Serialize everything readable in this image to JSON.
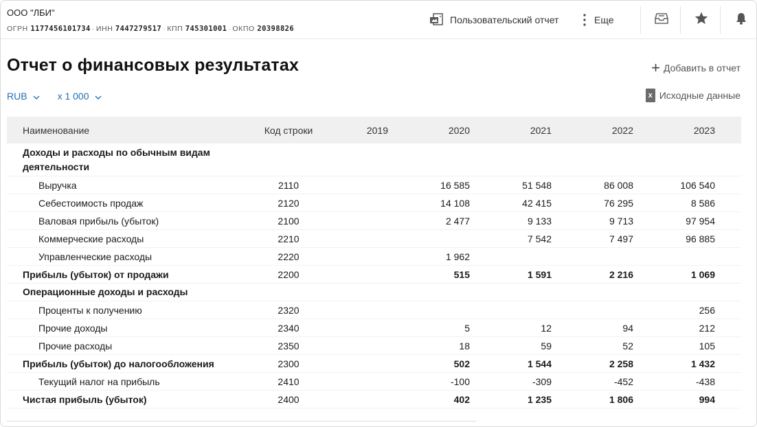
{
  "header": {
    "company_name": "ООО \"ЛБИ\"",
    "ogrn_label": "ОГРН",
    "ogrn": "1177456101734",
    "inn_label": "ИНН",
    "inn": "7447279517",
    "kpp_label": "КПП",
    "kpp": "745301001",
    "okpo_label": "ОКПО",
    "okpo": "20398826",
    "custom_report_label": "Пользовательский отчет",
    "more_label": "Еще",
    "icons": [
      "pdf-report-icon",
      "kebab-icon",
      "inbox-icon",
      "star-icon",
      "bell-icon"
    ]
  },
  "page": {
    "title": "Отчет о финансовых результатах",
    "add_to_report_label": "Добавить в отчет",
    "currency": "RUB",
    "multiplier": "х 1 000",
    "source_data_label": "Исходные данные"
  },
  "table": {
    "columns": {
      "name": "Наименование",
      "code": "Код строки",
      "y2019": "2019",
      "y2020": "2020",
      "y2021": "2021",
      "y2022": "2022",
      "y2023": "2023"
    },
    "rows": [
      {
        "name": "Доходы и расходы по обычным видам деятельности",
        "code": "",
        "y2019": "",
        "y2020": "",
        "y2021": "",
        "y2022": "",
        "y2023": ""
      },
      {
        "name": "Выручка",
        "code": "2110",
        "y2019": "",
        "y2020": "16 585",
        "y2021": "51 548",
        "y2022": "86 008",
        "y2023": "106 540"
      },
      {
        "name": "Себестоимость продаж",
        "code": "2120",
        "y2019": "",
        "y2020": "14 108",
        "y2021": "42 415",
        "y2022": "76 295",
        "y2023": "8 586"
      },
      {
        "name": "Валовая прибыль (убыток)",
        "code": "2100",
        "y2019": "",
        "y2020": "2 477",
        "y2021": "9 133",
        "y2022": "9 713",
        "y2023": "97 954"
      },
      {
        "name": "Коммерческие расходы",
        "code": "2210",
        "y2019": "",
        "y2020": "",
        "y2021": "7 542",
        "y2022": "7 497",
        "y2023": "96 885"
      },
      {
        "name": "Управленческие расходы",
        "code": "2220",
        "y2019": "",
        "y2020": "1 962",
        "y2021": "",
        "y2022": "",
        "y2023": ""
      },
      {
        "name": "Прибыль (убыток) от продажи",
        "code": "2200",
        "y2019": "",
        "y2020": "515",
        "y2021": "1 591",
        "y2022": "2 216",
        "y2023": "1 069"
      },
      {
        "name": "Операционные доходы и расходы",
        "code": "",
        "y2019": "",
        "y2020": "",
        "y2021": "",
        "y2022": "",
        "y2023": ""
      },
      {
        "name": "Проценты к получению",
        "code": "2320",
        "y2019": "",
        "y2020": "",
        "y2021": "",
        "y2022": "",
        "y2023": "256"
      },
      {
        "name": "Прочие доходы",
        "code": "2340",
        "y2019": "",
        "y2020": "5",
        "y2021": "12",
        "y2022": "94",
        "y2023": "212"
      },
      {
        "name": "Прочие расходы",
        "code": "2350",
        "y2019": "",
        "y2020": "18",
        "y2021": "59",
        "y2022": "52",
        "y2023": "105"
      },
      {
        "name": "Прибыль (убыток) до налогообложения",
        "code": "2300",
        "y2019": "",
        "y2020": "502",
        "y2021": "1 544",
        "y2022": "2 258",
        "y2023": "1 432"
      },
      {
        "name": "Текущий налог на прибыль",
        "code": "2410",
        "y2019": "",
        "y2020": "-100",
        "y2021": "-309",
        "y2022": "-452",
        "y2023": "-438"
      },
      {
        "name": "Чистая прибыль (убыток)",
        "code": "2400",
        "y2019": "",
        "y2020": "402",
        "y2021": "1 235",
        "y2022": "1 806",
        "y2023": "994"
      }
    ]
  }
}
